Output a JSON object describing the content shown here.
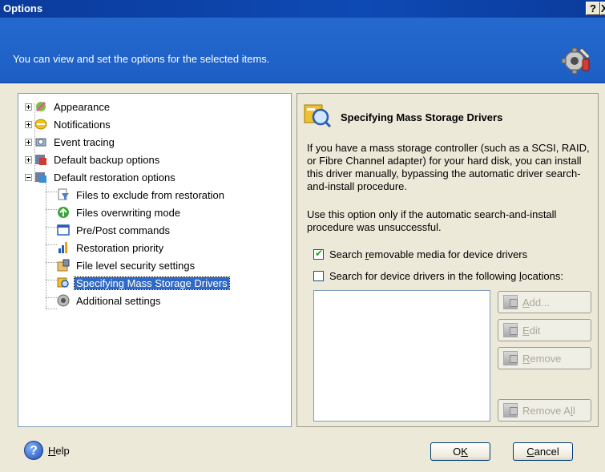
{
  "window": {
    "title": "Options",
    "help_btn": "?",
    "close_btn": "X"
  },
  "header": {
    "text": "You can view and set the options for the selected items."
  },
  "tree": {
    "items": [
      {
        "label": "Appearance"
      },
      {
        "label": "Notifications"
      },
      {
        "label": "Event tracing"
      },
      {
        "label": "Default backup options"
      },
      {
        "label": "Default restoration options"
      },
      {
        "label": "Files to exclude from restoration"
      },
      {
        "label": "Files overwriting mode"
      },
      {
        "label": "Pre/Post commands"
      },
      {
        "label": "Restoration priority"
      },
      {
        "label": "File level security settings"
      },
      {
        "label": "Specifying Mass Storage Drivers"
      },
      {
        "label": "Additional settings"
      }
    ]
  },
  "panel": {
    "title": "Specifying Mass Storage Drivers",
    "para1": "If you have a mass storage controller (such as a SCSI, RAID, or Fibre Channel adapter) for your hard disk, you can install this driver manually, bypassing the automatic driver search-and-install procedure.",
    "para2": "Use this option only if the automatic search-and-install procedure was unsuccessful.",
    "chk1": {
      "pre": "Search ",
      "u": "r",
      "post": "emovable media for device drivers",
      "checked": true
    },
    "chk2": {
      "pre": "Search for device drivers in the following ",
      "u": "l",
      "post": "ocations:",
      "checked": false
    },
    "buttons": {
      "add": {
        "u": "A",
        "post": "dd..."
      },
      "edit": {
        "u": "E",
        "post": "dit"
      },
      "remove": {
        "u": "R",
        "post": "emove"
      },
      "remove_all": {
        "pre": "Remove A",
        "u": "l",
        "post": "l"
      }
    }
  },
  "footer": {
    "help": {
      "u": "H",
      "post": "elp"
    },
    "ok": {
      "pre": "O",
      "u": "K"
    },
    "cancel": {
      "u": "C",
      "post": "ancel"
    }
  }
}
